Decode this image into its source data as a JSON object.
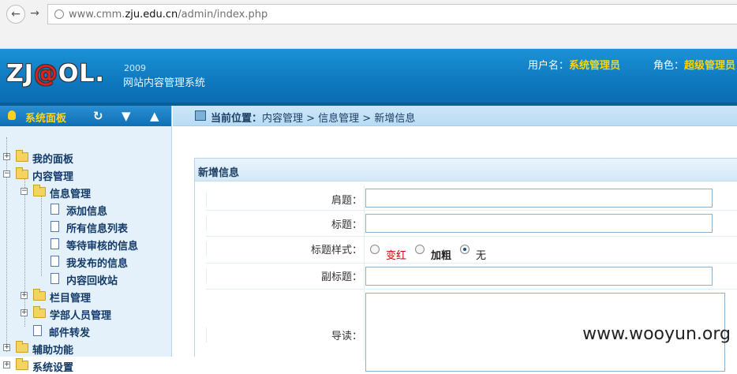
{
  "browser": {
    "url_prefix": "www.cmm.",
    "url_domain": "zju.edu.cn",
    "url_path": "/admin/index.php"
  },
  "header": {
    "logo_text": "ZJ",
    "logo_at": "@",
    "logo_end": "OL.",
    "year": "2009",
    "subtitle": "网站内容管理系统",
    "username_label": "用户名：",
    "username_value": "系统管理员",
    "role_label": "角色：",
    "role_value": "超级管理员"
  },
  "sidebar": {
    "title": "系统面板",
    "icons": [
      "refresh-icon",
      "collapse-down-icon",
      "collapse-up-icon"
    ],
    "tree": {
      "my_panel": "我的面板",
      "content_mgmt": "内容管理",
      "info_mgmt": "信息管理",
      "add_info": "添加信息",
      "all_info": "所有信息列表",
      "pending": "等待审核的信息",
      "my_published": "我发布的信息",
      "recycle": "内容回收站",
      "column_mgmt": "栏目管理",
      "dept_staff": "学部人员管理",
      "mail_forward": "邮件转发",
      "aux": "辅助功能",
      "system": "系统设置"
    }
  },
  "breadcrumb": {
    "label": "当前位置：",
    "path": "内容管理 > 信息管理 > 新增信息"
  },
  "form": {
    "title": "新增信息",
    "shoulder_label": "肩题：",
    "title_label": "标题：",
    "style_label": "标题样式：",
    "style_options": [
      "变红",
      "加粗",
      "无"
    ],
    "style_selected": "无",
    "subtitle_label": "副标题：",
    "lead_label": "导读："
  },
  "watermark": "www.wooyun.org",
  "colors": {
    "accent": "#0f78bf",
    "highlight": "#ffd400",
    "red_option": "#cc0000"
  }
}
